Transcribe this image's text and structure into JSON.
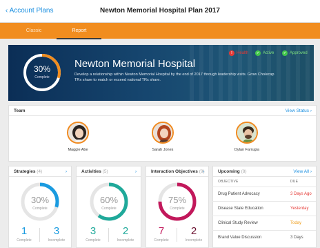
{
  "nav": {
    "back_label": "Account Plans",
    "title": "Newton Memorial Hospital Plan 2017"
  },
  "tabs": [
    {
      "label": "Classic"
    },
    {
      "label": "Report"
    }
  ],
  "hero": {
    "percent_label": "30%",
    "progress": 0.3,
    "complete_label": "Complete",
    "title": "Newton Memorial Hospital",
    "description": "Develop a relationship within Newton Memorial Hospital by the end of 2017 through leadership visits. Grow Cholecap TRx share to match or exceed national TRx share.",
    "statuses": [
      {
        "label": "Health",
        "color": "#e53935",
        "icon": "exclamation-icon"
      },
      {
        "label": "Active",
        "color": "#43c84b",
        "icon": "check-icon"
      },
      {
        "label": "Approved",
        "color": "#43c84b",
        "icon": "check-icon"
      }
    ]
  },
  "team": {
    "title": "Team",
    "link_label": "View Status",
    "members": [
      {
        "name": "Maggie Abe"
      },
      {
        "name": "Sarah Jones"
      },
      {
        "name": "Dylan Farrugia"
      }
    ]
  },
  "strategies": {
    "title": "Strategies",
    "count": "(4)",
    "percent_label": "30%",
    "progress": 0.3,
    "complete_label": "Complete",
    "complete_count": "1",
    "incomplete_count": "3",
    "complete_text": "Complete",
    "incomplete_text": "Incomplete",
    "color": "#1a9be0"
  },
  "activities": {
    "title": "Activities",
    "count": "(5)",
    "percent_label": "60%",
    "progress": 0.6,
    "complete_label": "Complete",
    "complete_count": "3",
    "incomplete_count": "2",
    "complete_text": "Complete",
    "incomplete_text": "Incomplete",
    "color": "#1fa99a"
  },
  "objectives": {
    "title": "Interaction Objectives",
    "count": "(9)",
    "percent_label": "75%",
    "progress": 0.75,
    "complete_label": "Complete",
    "complete_count": "7",
    "incomplete_count": "2",
    "complete_text": "Complete",
    "incomplete_text": "Incomplete",
    "color": "#c2185b"
  },
  "upcoming": {
    "title": "Upcoming",
    "count": "(8)",
    "link_label": "View All",
    "col_objective": "OBJECTIVE",
    "col_due": "DUE",
    "rows": [
      {
        "objective": "Drug Patient Advocacy",
        "due": "3 Days Ago",
        "color": "#e53935"
      },
      {
        "objective": "Disease State Education",
        "due": "Yesterday",
        "color": "#e53935"
      },
      {
        "objective": "Clinical Study Review",
        "due": "Today",
        "color": "#f0a020"
      },
      {
        "objective": "Brand Value Discussion",
        "due": "3 Days",
        "color": "#555555"
      }
    ]
  }
}
